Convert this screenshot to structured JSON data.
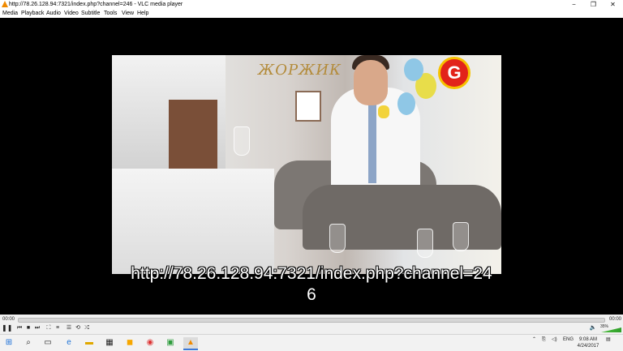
{
  "window": {
    "title": "http://78.26.128.94:7321/index.php?channel=246 - VLC media player",
    "minimize": "−",
    "maximize": "❐",
    "close": "✕"
  },
  "menu": [
    "Media",
    "Playback",
    "Audio",
    "Video",
    "Subtitle",
    "Tools",
    "View",
    "Help"
  ],
  "video": {
    "subtitle_line1": "http://78.26.128.94:7321/index.php?channel=24",
    "subtitle_line2": "6",
    "wall_sign": "ЖОРЖИК",
    "channel_logo": "G"
  },
  "player": {
    "elapsed": "00:00",
    "duration": "00:00",
    "volume_percent": "35%",
    "volume_level": 0.35
  },
  "taskbar": {
    "language": "ENG",
    "time": "9:08 AM",
    "date": "4/24/2017"
  },
  "colors": {
    "vlc_orange": "#f08a00",
    "volume_green": "#3faf35",
    "logo_red": "#e2231a"
  }
}
